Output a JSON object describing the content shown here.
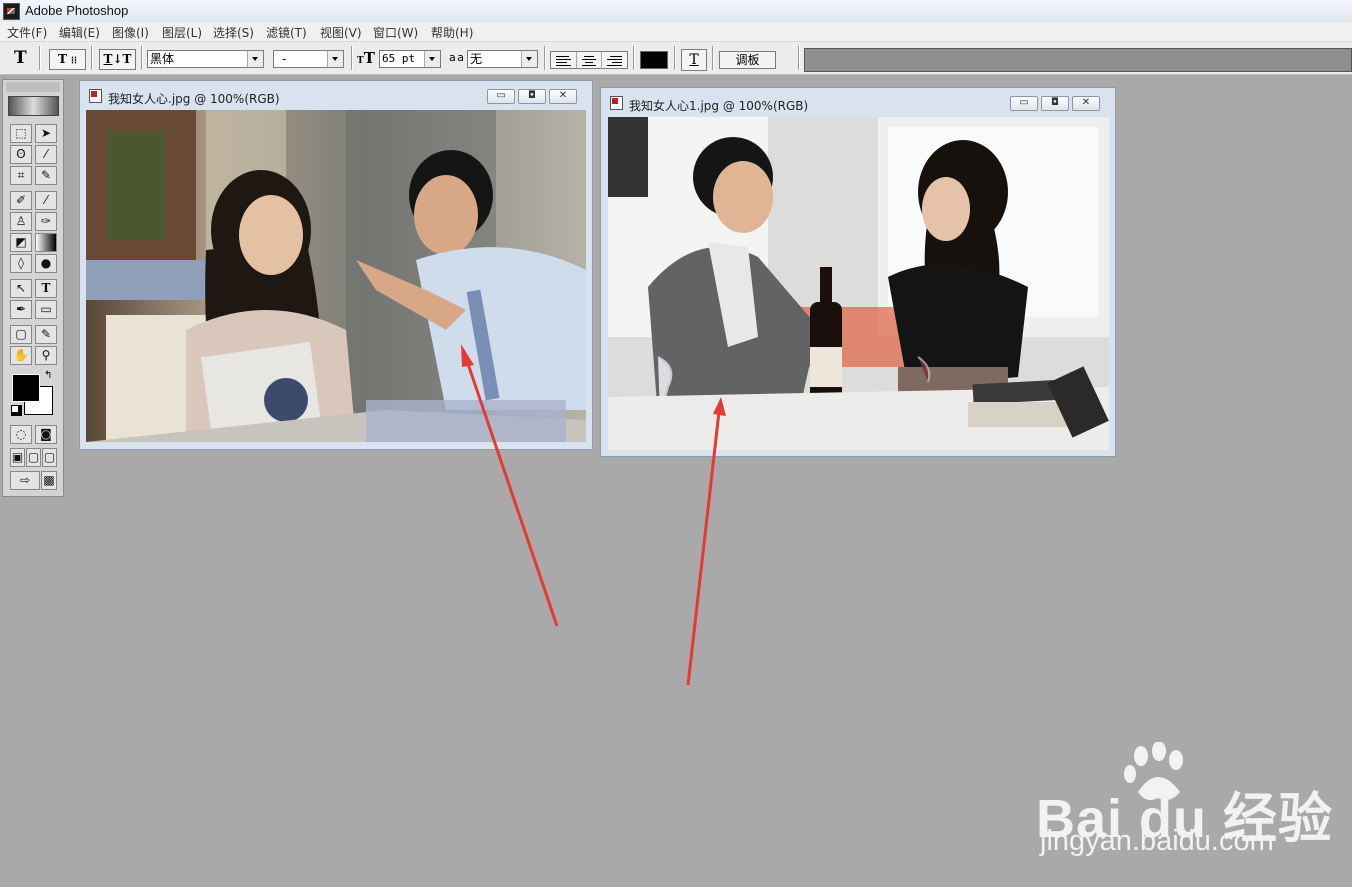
{
  "app": {
    "title": "Adobe Photoshop"
  },
  "menu": [
    "文件(F)",
    "编辑(E)",
    "图像(I)",
    "图层(L)",
    "选择(S)",
    "滤镜(T)",
    "视图(V)",
    "窗口(W)",
    "帮助(H)"
  ],
  "options_bar": {
    "tool_glyph": "T",
    "font_family": "黑体",
    "font_style": "-",
    "font_size": "65 pt",
    "antialias_glyph": "a a",
    "antialias": "无",
    "text_color": "#000000",
    "palette_button": "调板"
  },
  "toolbox": {
    "tools": [
      "rect-marquee",
      "move",
      "lasso",
      "magic-wand",
      "crop",
      "eyedropper",
      "healing",
      "brush",
      "stamp",
      "history-brush",
      "eraser",
      "gradient",
      "blur",
      "dodge",
      "path-select",
      "type",
      "pen",
      "shape",
      "notes",
      "eyedropper-2",
      "hand",
      "zoom"
    ],
    "foreground": "#000000",
    "background": "#ffffff"
  },
  "documents": [
    {
      "title": "我知女人心.jpg @ 100%(RGB)",
      "scene": "woman-man-pointing"
    },
    {
      "title": "我知女人心1.jpg @ 100%(RGB)",
      "scene": "couple-wine-table"
    }
  ],
  "annotations": {
    "arrow_color": "#e53935"
  },
  "watermark": {
    "brand": "Bai du 经验",
    "url": "jingyan.baidu.com"
  }
}
